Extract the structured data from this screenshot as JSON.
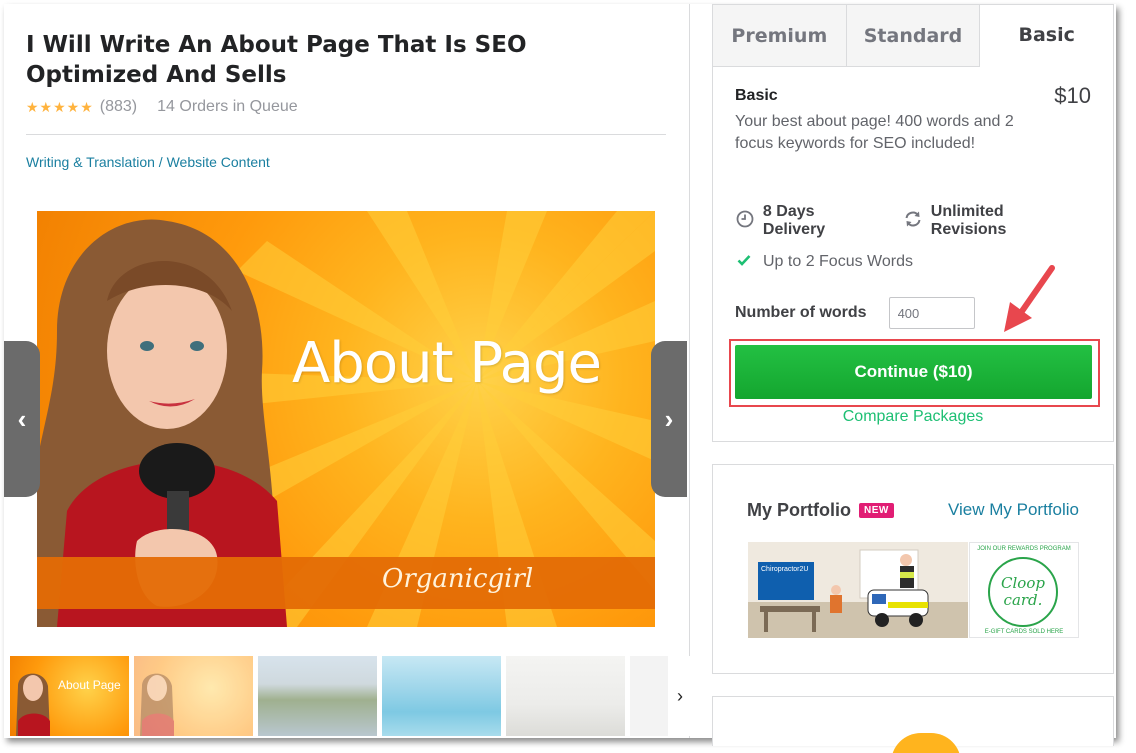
{
  "gig": {
    "title": "I Will Write An About Page That Is SEO Optimized And Sells",
    "stars": "★★★★★",
    "rating_count": "(883)",
    "orders_in_queue": "14 Orders in Queue",
    "breadcrumb": {
      "category": "Writing & Translation",
      "separator": " / ",
      "subcategory": "Website Content"
    }
  },
  "main_image": {
    "headline": "About Page",
    "signature": "Organicgirl"
  },
  "slider": {
    "prev_icon": "‹",
    "next_icon": "›"
  },
  "thumbnails": [
    {
      "label": "About Page"
    },
    {
      "label": ""
    },
    {
      "label": ""
    },
    {
      "label": ""
    },
    {
      "label": ""
    },
    {
      "label": ""
    }
  ],
  "package": {
    "tabs": [
      "Premium",
      "Standard",
      "Basic"
    ],
    "active_tab": "Basic",
    "name": "Basic",
    "price": "$10",
    "description": "Your best about page! 400 words and 2 focus keywords for SEO included!",
    "delivery": "8 Days Delivery",
    "revisions": "Unlimited Revisions",
    "focus_words": "Up to 2 Focus Words",
    "words_label": "Number of words",
    "words_value": "400",
    "continue_label": "Continue ($10)",
    "compare_label": "Compare Packages"
  },
  "portfolio": {
    "title": "My Portfolio",
    "badge": "NEW",
    "view_link": "View My Portfolio",
    "item1_brand": "Chiropractor2U",
    "item2_top": "JOIN OUR REWARDS PROGRAM",
    "item2_logo": "Cloop card.",
    "item2_bottom": "E-GIFT CARDS SOLD HERE"
  },
  "colors": {
    "accent_green": "#1dbf73",
    "button_green": "#14a62f",
    "link_blue": "#1a7fa0",
    "star_yellow": "#ffb33e",
    "highlight_red": "#e8474e",
    "badge_pink": "#e11d74"
  }
}
